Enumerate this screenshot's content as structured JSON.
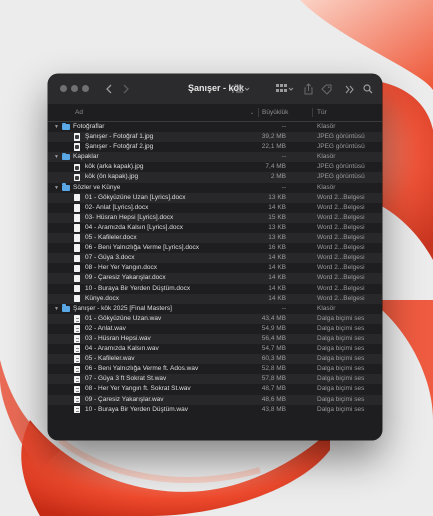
{
  "window": {
    "title": "Şanışer - kök"
  },
  "colors": {
    "window_bg": "#1e1e20",
    "folder": "#5aa7e6",
    "accent_wallpaper": "#ef4b2e"
  },
  "icons": {
    "back": "chevron-left-icon",
    "forward": "chevron-right-icon",
    "view": "list-view-icon",
    "group": "group-icon",
    "share": "share-icon",
    "tag": "tag-icon",
    "more": "double-chevron-right-icon",
    "search": "search-icon"
  },
  "columns": {
    "name": "Ad",
    "size": "Büyüklük",
    "kind": "Tür"
  },
  "rows": [
    {
      "level": 0,
      "type": "folder",
      "name": "Fotoğraflar",
      "size": "--",
      "kind": "Klasör"
    },
    {
      "level": 1,
      "type": "image",
      "name": "Şanışer - Fotoğraf 1.jpg",
      "size": "39,2 MB",
      "kind": "JPEG görüntüsü"
    },
    {
      "level": 1,
      "type": "image",
      "name": "Şanışer - Fotoğraf 2.jpg",
      "size": "22,1 MB",
      "kind": "JPEG görüntüsü"
    },
    {
      "level": 0,
      "type": "folder",
      "name": "Kapaklar",
      "size": "--",
      "kind": "Klasör"
    },
    {
      "level": 1,
      "type": "image",
      "name": "kök (arka kapak).jpg",
      "size": "7,4 MB",
      "kind": "JPEG görüntüsü"
    },
    {
      "level": 1,
      "type": "image",
      "name": "kök (ön kapak).jpg",
      "size": "2 MB",
      "kind": "JPEG görüntüsü"
    },
    {
      "level": 0,
      "type": "folder",
      "name": "Sözler ve Künye",
      "size": "--",
      "kind": "Klasör"
    },
    {
      "level": 1,
      "type": "doc",
      "name": "01 - Gökyüzüne Uzan [Lyrics].docx",
      "size": "13 KB",
      "kind": "Word 2...Belgesi"
    },
    {
      "level": 1,
      "type": "doc",
      "name": "02- Anlat [Lyrics].docx",
      "size": "14 KB",
      "kind": "Word 2...Belgesi"
    },
    {
      "level": 1,
      "type": "doc",
      "name": "03- Hüsran Hepsi [Lyrics].docx",
      "size": "15 KB",
      "kind": "Word 2...Belgesi"
    },
    {
      "level": 1,
      "type": "doc",
      "name": "04 - Aramızda Kalsın [Lyrics].docx",
      "size": "13 KB",
      "kind": "Word 2...Belgesi"
    },
    {
      "level": 1,
      "type": "doc",
      "name": "05 - Kafileler.docx",
      "size": "13 KB",
      "kind": "Word 2...Belgesi"
    },
    {
      "level": 1,
      "type": "doc",
      "name": "06 - Beni Yalnızlığa Verme [Lyrics].docx",
      "size": "16 KB",
      "kind": "Word 2...Belgesi"
    },
    {
      "level": 1,
      "type": "doc",
      "name": "07 - Güya 3.docx",
      "size": "14 KB",
      "kind": "Word 2...Belgesi"
    },
    {
      "level": 1,
      "type": "doc",
      "name": "08 - Her Yer Yangın.docx",
      "size": "14 KB",
      "kind": "Word 2...Belgesi"
    },
    {
      "level": 1,
      "type": "doc",
      "name": "09 - Çaresiz Yakarışlar.docx",
      "size": "14 KB",
      "kind": "Word 2...Belgesi"
    },
    {
      "level": 1,
      "type": "doc",
      "name": "10 - Buraya Bir Yerden Düştüm.docx",
      "size": "14 KB",
      "kind": "Word 2...Belgesi"
    },
    {
      "level": 1,
      "type": "doc",
      "name": "Künye.docx",
      "size": "14 KB",
      "kind": "Word 2...Belgesi"
    },
    {
      "level": 0,
      "type": "folder",
      "name": "Şanışer - kök 2025 [Final Masters]",
      "size": "--",
      "kind": "Klasör"
    },
    {
      "level": 1,
      "type": "audio",
      "name": "01 - Gökyüzüne Uzan.wav",
      "size": "43,4 MB",
      "kind": "Dalga biçimi ses"
    },
    {
      "level": 1,
      "type": "audio",
      "name": "02 - Anlat.wav",
      "size": "54,9 MB",
      "kind": "Dalga biçimi ses"
    },
    {
      "level": 1,
      "type": "audio",
      "name": "03 - Hüsran Hepsi.wav",
      "size": "56,4 MB",
      "kind": "Dalga biçimi ses"
    },
    {
      "level": 1,
      "type": "audio",
      "name": "04 - Aramızda Kalsın.wav",
      "size": "54,7 MB",
      "kind": "Dalga biçimi ses"
    },
    {
      "level": 1,
      "type": "audio",
      "name": "05 - Kafileler.wav",
      "size": "60,3 MB",
      "kind": "Dalga biçimi ses"
    },
    {
      "level": 1,
      "type": "audio",
      "name": "06 - Beni Yalnızlığa Verme ft. Ados.wav",
      "size": "52,8 MB",
      "kind": "Dalga biçimi ses"
    },
    {
      "level": 1,
      "type": "audio",
      "name": "07 - Güya 3 ft Sokrat St.wav",
      "size": "57,8 MB",
      "kind": "Dalga biçimi ses"
    },
    {
      "level": 1,
      "type": "audio",
      "name": "08 - Her Yer Yangın ft. Sokrat St.wav",
      "size": "48,7 MB",
      "kind": "Dalga biçimi ses"
    },
    {
      "level": 1,
      "type": "audio",
      "name": "09 - Çaresiz Yakarışlar.wav",
      "size": "48,6 MB",
      "kind": "Dalga biçimi ses"
    },
    {
      "level": 1,
      "type": "audio",
      "name": "10 - Buraya Bir Yerden Düştüm.wav",
      "size": "43,8 MB",
      "kind": "Dalga biçimi ses"
    }
  ]
}
